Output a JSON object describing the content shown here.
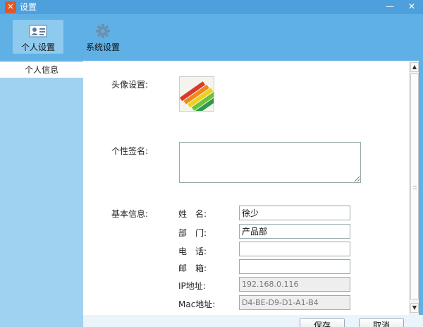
{
  "window": {
    "title": "设置",
    "app_icon_glyph": "✕",
    "minimize_glyph": "—",
    "close_glyph": "✕"
  },
  "toolbar": {
    "items": [
      {
        "label": "个人设置",
        "icon": "id-card-icon",
        "active": true
      },
      {
        "label": "系统设置",
        "icon": "gear-icon",
        "active": false
      }
    ]
  },
  "sidebar": {
    "items": [
      {
        "label": "个人信息",
        "selected": true
      }
    ]
  },
  "form": {
    "avatar_label": "头像设置:",
    "signature_label": "个性签名:",
    "signature_value": "",
    "basic_info_label": "基本信息:",
    "fields": [
      {
        "label": "姓　名:",
        "value": "徐少",
        "readonly": false
      },
      {
        "label": "部　门:",
        "value": "产品部",
        "readonly": false
      },
      {
        "label": "电　话:",
        "value": "",
        "readonly": false
      },
      {
        "label": "邮　箱:",
        "value": "",
        "readonly": false
      },
      {
        "label": "IP地址:",
        "value": "192.168.0.116",
        "readonly": true
      },
      {
        "label": "Mac地址:",
        "value": "D4-BE-D9-D1-A1-B4",
        "readonly": true
      }
    ]
  },
  "buttons": {
    "save": "保存",
    "cancel": "取消"
  },
  "colors": {
    "titlebar": "#4da0dc",
    "toolbar": "#5fb0e4",
    "sidebar": "#9fd2f0",
    "active_tool": "#8ec9ee"
  }
}
